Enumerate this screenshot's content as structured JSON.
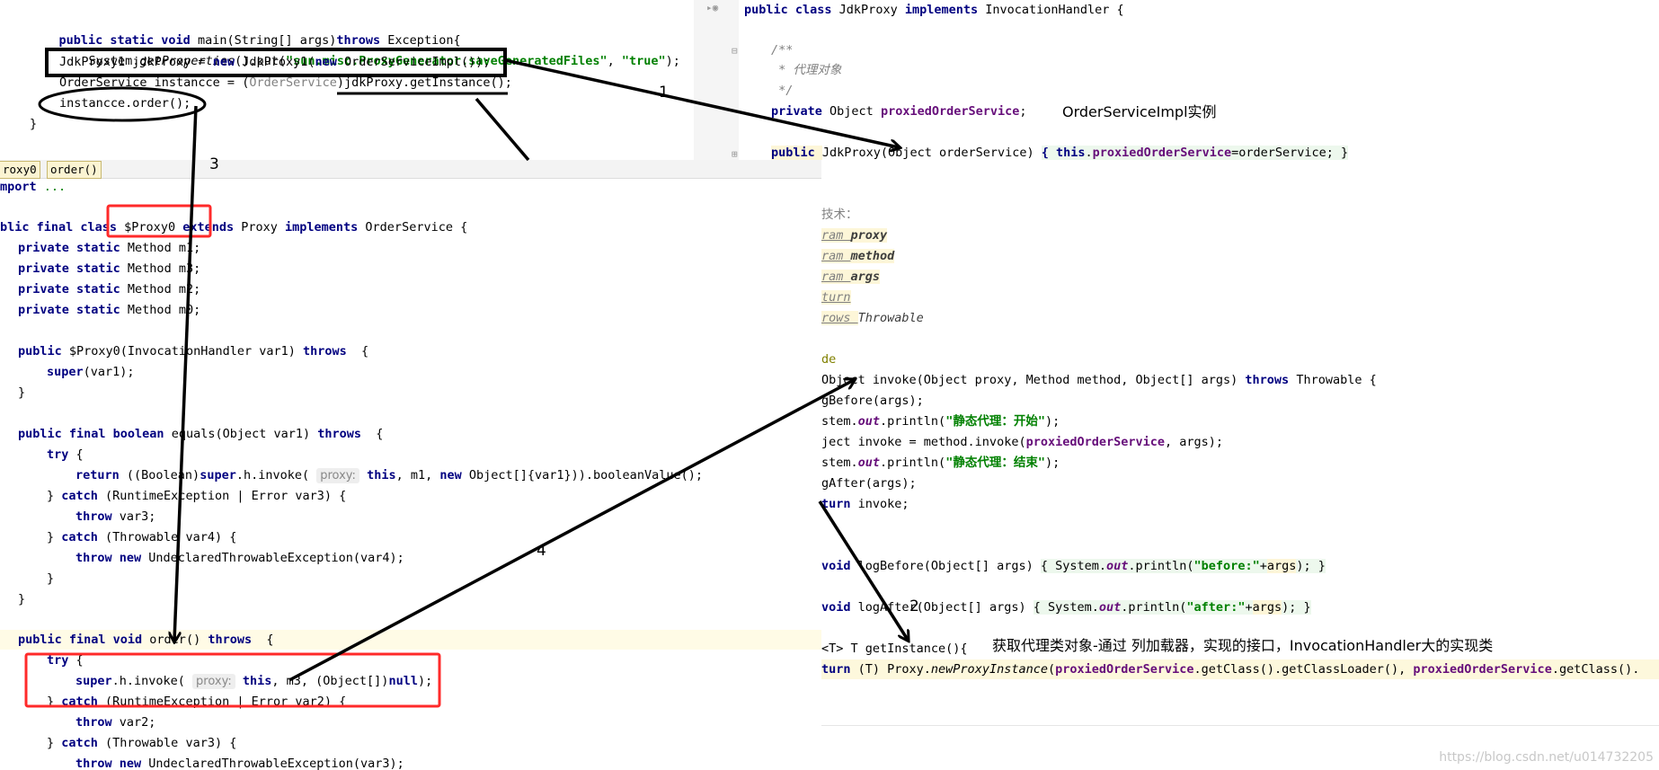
{
  "top_left": {
    "lines": [
      "main_sig",
      "set_props",
      "create_proxy",
      "get_instance",
      "call_order",
      "close"
    ],
    "tabs": [
      "roxy0",
      "order()"
    ]
  },
  "labels": {
    "arrow1": "1",
    "arrow3": "3",
    "arrow4": "4",
    "arrow2": "2",
    "order_impl": "OrderServiceImpl实例",
    "get_proxy_note": "获取代理类对象-通过 列加载器，实现的接口，InvocationHandler大的实现类",
    "watermark": "https://blog.csdn.net/u014732205"
  },
  "code": {
    "tl_main": "public static void main(String[] args)throws Exception{",
    "tl_props_a": "System.",
    "tl_props_b": "getProperties",
    "tl_props_c": "().put(",
    "tl_props_str1": "\"sun.misc.ProxyGenerator.saveGeneratedFiles\"",
    "tl_props_d": ", ",
    "tl_props_str2": "\"true\"",
    "tl_props_e": ");",
    "tl_new": "JdkProxy1 jdkProxy = new JdkProxy1(new OrderServiceImpl());",
    "tl_get": "OrderService instancce = (OrderService)jdkProxy.getInstance();",
    "tl_call": "instancce.order();",
    "tl_close": "}",
    "tr_class": "public class JdkProxy implements InvocationHandler {",
    "tr_c1": "/**",
    "tr_c2": " * 代理对象",
    "tr_c3": " */",
    "tr_field_a": "private ",
    "tr_field_b": "Object ",
    "tr_field_c": "proxiedOrderService",
    "tr_field_d": ";",
    "tr_ctor_a": "public ",
    "tr_ctor_b": "JdkProxy(Object orderService) ",
    "tr_ctor_c": "{ this.",
    "tr_ctor_d": "proxiedOrderService",
    "tr_ctor_e": "=orderService; }",
    "m_import_a": "mport ",
    "m_import_b": "...",
    "m_class": "blic final class $Proxy0 extends Proxy implements OrderService {",
    "m_f1": "private static Method m1;",
    "m_f2": "private static Method m3;",
    "m_f3": "private static Method m2;",
    "m_f4": "private static Method m0;",
    "m_ctor": "public $Proxy0(InvocationHandler var1) throws  {",
    "m_super": "super(var1);",
    "m_close1": "}",
    "m_eq": "public final boolean equals(Object var1) throws  {",
    "m_try": "try {",
    "m_ret_a": "return ((Boolean)super.h.invoke( ",
    "m_ret_hint": "proxy:",
    "m_ret_b": " this, m1, new Object[]{var1})).booleanValue();",
    "m_catch1": "} catch (RuntimeException | Error var3) {",
    "m_throw1": "throw var3;",
    "m_catch2": "} catch (Throwable var4) {",
    "m_throw2": "throw new UndeclaredThrowableException(var4);",
    "m_close2": "}",
    "m_close3": "}",
    "m_order": "public final void order() throws  {",
    "m_try2": "try {",
    "m_inv_a": "super.h.invoke( ",
    "m_inv_hint": "proxy:",
    "m_inv_b": " this, m3, (Object[])null);",
    "m_catch3": "} catch (RuntimeException | Error var2) {",
    "m_throw3": "throw var2;",
    "m_catch4": "} catch (Throwable var3) {",
    "m_throw4": "throw new UndeclaredThrowableException(var3);",
    "r_tech": "技术：",
    "r_p1a": "ram ",
    "r_p1b": "proxy",
    "r_p2a": "ram ",
    "r_p2b": "method",
    "r_p3a": "ram ",
    "r_p3b": "args",
    "r_ret": "turn",
    "r_throws_a": "rows ",
    "r_throws_b": "Throwable",
    "r_override": "de",
    "r_invoke": "Object invoke(Object proxy, Method method, Object[] args) throws Throwable {",
    "r_before": "gBefore(args);",
    "r_sys1a": "stem.",
    "r_sys1b": "out",
    "r_sys1c": ".println(",
    "r_sys1d": "\"静态代理：开始\"",
    "r_sys1e": ");",
    "r_obj_a": "ject invoke = method.invoke(",
    "r_obj_b": "proxiedOrderService",
    "r_obj_c": ", args);",
    "r_sys2a": "stem.",
    "r_sys2b": "out",
    "r_sys2c": ".println(",
    "r_sys2d": "\"静态代理：结束\"",
    "r_sys2e": ");",
    "r_after": "gAfter(args);",
    "r_return": "turn invoke;",
    "r_lb_a": " void logBefore(Object[] args) ",
    "r_lb_b": "{ System.",
    "r_lb_c": "out",
    "r_lb_d": ".println(",
    "r_lb_e": "\"before:\"",
    "r_lb_f": "+args); }",
    "r_la_a": " void logAfter(Object[] args) ",
    "r_la_b": "{ System.",
    "r_la_c": "out",
    "r_la_d": ".println(",
    "r_la_e": "\"after:\"",
    "r_la_f": "+args); }",
    "r_gi": " <T> T getInstance(){",
    "r_gr_a": "turn ",
    "r_gr_b": "(T) Proxy.",
    "r_gr_c": "newProxyInstance",
    "r_gr_d": "(",
    "r_gr_e": "proxiedOrderService",
    "r_gr_f": ".getClass().getClassLoader(), ",
    "r_gr_g": "proxiedOrderService",
    "r_gr_h": ".getClass()."
  },
  "colors": {
    "keyword": "#000080",
    "field": "#660e7a",
    "string": "#008000",
    "annotation_red": "#ff2a2a",
    "annotation_black": "#000000"
  }
}
